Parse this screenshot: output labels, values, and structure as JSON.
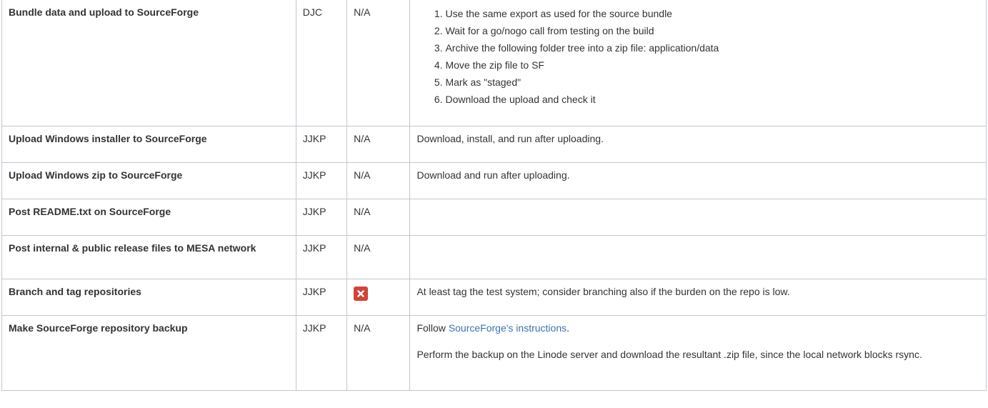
{
  "rows": [
    {
      "task": "Bundle data and upload to SourceForge",
      "owner": "DJC",
      "status": "N/A",
      "steps": [
        "Use the same export as used for the source bundle",
        "Wait for a go/nogo call from testing on the build",
        "Archive the following folder tree into a zip file: application/data",
        "Move the zip file to SF",
        "Mark as \"staged\"",
        "Download the upload and check it"
      ]
    },
    {
      "task": "Upload Windows installer to SourceForge",
      "owner": "JJKP",
      "status": "N/A",
      "notes": "Download, install, and run after uploading."
    },
    {
      "task": "Upload Windows zip to SourceForge",
      "owner": "JJKP",
      "status": "N/A",
      "notes": "Download and run after uploading."
    },
    {
      "task": "Post README.txt on SourceForge",
      "owner": "JJKP",
      "status": "N/A",
      "notes": ""
    },
    {
      "task": "Post internal & public release files to MESA network",
      "owner": "JJKP",
      "status": "N/A",
      "notes": ""
    },
    {
      "task": "Branch and tag repositories",
      "owner": "JJKP",
      "status_icon": "error-x-icon",
      "status_color": "#d04437",
      "notes": "At least tag the test system; consider branching also if the burden on the repo is low."
    },
    {
      "task": "Make SourceForge repository backup",
      "owner": "JJKP",
      "status": "N/A",
      "notes_prefix": "Follow ",
      "notes_link": "SourceForge's instructions",
      "notes_suffix": ".",
      "notes_2": "Perform the backup on the Linode server and download the resultant .zip file, since the local network blocks rsync."
    }
  ],
  "colors": {
    "border": "#c1c7d0",
    "text": "#333333",
    "link": "#3b73af",
    "error": "#d04437"
  }
}
